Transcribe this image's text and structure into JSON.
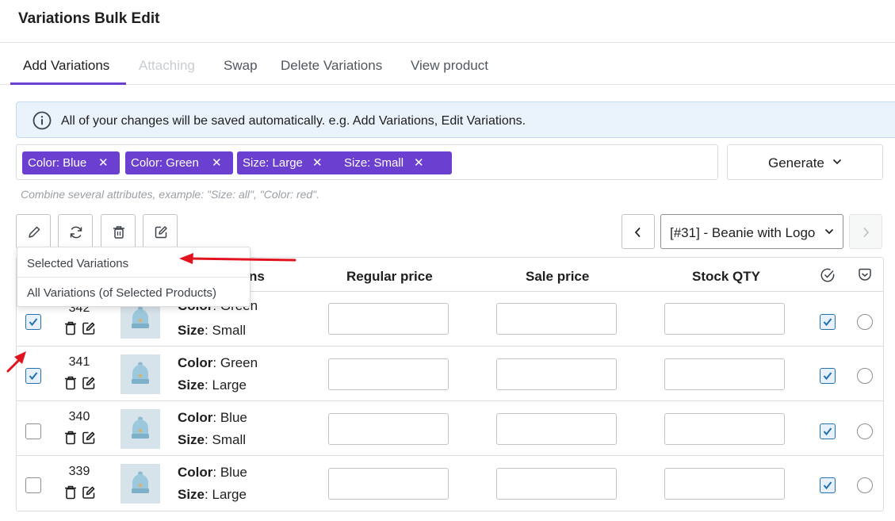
{
  "header": {
    "title": "Variations Bulk Edit"
  },
  "tabs": [
    {
      "label": "Add Variations",
      "state": "active"
    },
    {
      "label": "Attaching",
      "state": "disabled"
    },
    {
      "label": "Swap",
      "state": "normal"
    },
    {
      "label": "Delete Variations",
      "state": "normal"
    },
    {
      "label": "View product",
      "state": "normal"
    }
  ],
  "notice": {
    "icon": "info-icon",
    "text": "All of your changes will be saved automatically. e.g. Add Variations, Edit Variations."
  },
  "attributes": {
    "chips": [
      {
        "label": "Color: Blue",
        "remove": "✕"
      },
      {
        "label": "Color: Green",
        "remove": "✕"
      },
      {
        "label": "Size: Large",
        "remove": "✕"
      },
      {
        "label": "Size: Small",
        "remove": "✕"
      }
    ],
    "hint": "Combine several attributes, example: \"Size: all\", \"Color: red\"."
  },
  "generate": {
    "label": "Generate"
  },
  "toolbar": {
    "icons": [
      "pencil-icon",
      "refresh-icon",
      "trash-icon",
      "edit-box-icon"
    ]
  },
  "product_selector": {
    "value": "[#31] - Beanie with Logo"
  },
  "table": {
    "headers": {
      "attributes": "ns",
      "regular_price": "Regular price",
      "sale_price": "Sale price",
      "stock_qty": "Stock QTY"
    },
    "attribute_names": {
      "color": "Color",
      "size": "Size"
    },
    "rows": [
      {
        "id": "342",
        "color": "Green",
        "size": "Small",
        "selected": true
      },
      {
        "id": "341",
        "color": "Green",
        "size": "Large",
        "selected": true
      },
      {
        "id": "340",
        "color": "Blue",
        "size": "Small",
        "selected": false
      },
      {
        "id": "339",
        "color": "Blue",
        "size": "Large",
        "selected": false
      }
    ]
  },
  "dropdown": {
    "items": [
      "Selected Variations",
      "All Variations (of Selected Products)"
    ]
  },
  "colors": {
    "accent": "#6b3fd0",
    "annotation": "#e0141e",
    "checkbox": "#2271b1"
  }
}
